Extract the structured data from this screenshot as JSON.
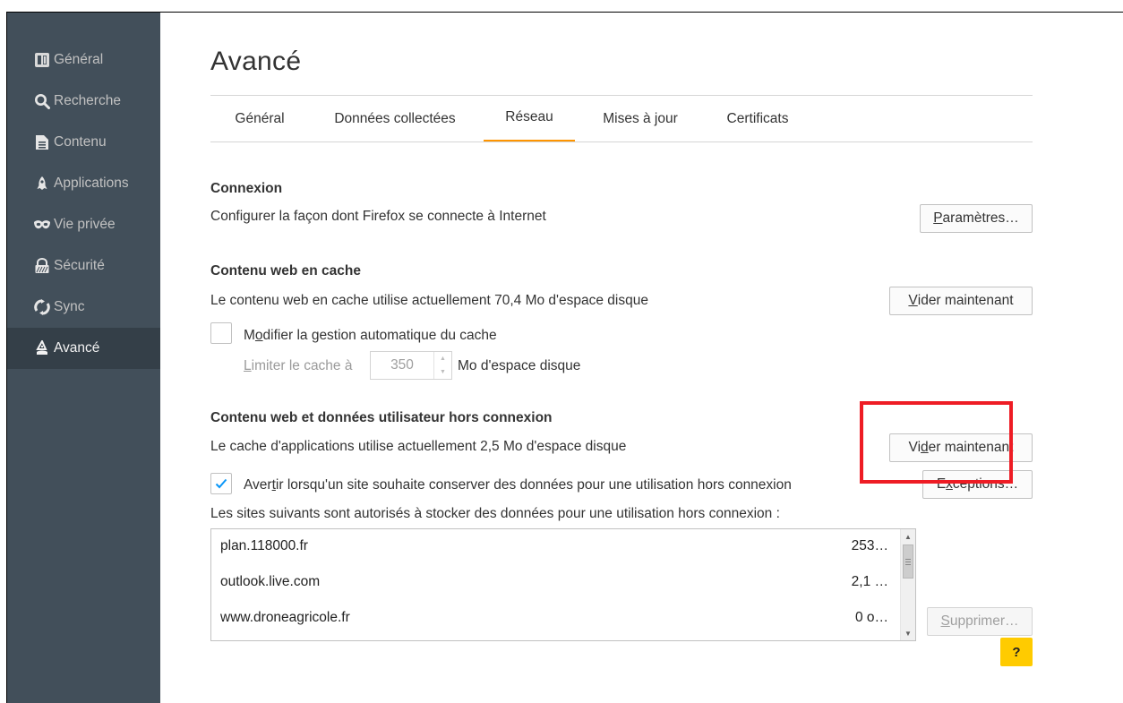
{
  "sidebar": {
    "items": [
      {
        "label": "Général",
        "icon": "general-icon"
      },
      {
        "label": "Recherche",
        "icon": "search-icon"
      },
      {
        "label": "Contenu",
        "icon": "content-icon"
      },
      {
        "label": "Applications",
        "icon": "applications-icon"
      },
      {
        "label": "Vie privée",
        "icon": "privacy-mask-icon"
      },
      {
        "label": "Sécurité",
        "icon": "security-icon"
      },
      {
        "label": "Sync",
        "icon": "sync-icon"
      },
      {
        "label": "Avancé",
        "icon": "advanced-icon",
        "active": true
      }
    ]
  },
  "header": {
    "title": "Avancé"
  },
  "tabs": [
    {
      "label": "Général"
    },
    {
      "label": "Données collectées"
    },
    {
      "label": "Réseau",
      "active": true
    },
    {
      "label": "Mises à jour"
    },
    {
      "label": "Certificats"
    }
  ],
  "connexion": {
    "title": "Connexion",
    "description": "Configurer la façon dont Firefox se connecte à Internet",
    "button_pre": "",
    "button_accel": "P",
    "button_post": "aramètres…"
  },
  "cache": {
    "title": "Contenu web en cache",
    "description": "Le contenu web en cache utilise actuellement 70,4 Mo d'espace disque",
    "button_pre": "",
    "button_accel": "V",
    "button_post": "ider maintenant",
    "override_pre": "M",
    "override_accel": "o",
    "override_post": "difier la gestion automatique du cache",
    "override_checked": false,
    "limit_pre": "",
    "limit_accel": "L",
    "limit_post": "imiter le cache à",
    "limit_value": "350",
    "limit_unit": "Mo d'espace disque"
  },
  "offline": {
    "title": "Contenu web et données utilisateur hors connexion",
    "description": "Le cache d'applications utilise actuellement 2,5 Mo d'espace disque",
    "button_pre": "Vi",
    "button_accel": "d",
    "button_post": "er maintenant",
    "warn_pre": "Aver",
    "warn_accel": "t",
    "warn_post": "ir lorsqu'un site souhaite conserver des données pour une utilisation hors connexion",
    "warn_checked": true,
    "exceptions_pre": "E",
    "exceptions_accel": "x",
    "exceptions_post": "ceptions…",
    "list_label": "Les sites suivants sont autorisés à stocker des données pour une utilisation hors connexion :",
    "sites": [
      {
        "site": "plan.118000.fr",
        "size": "253…"
      },
      {
        "site": "outlook.live.com",
        "size": "2,1 …"
      },
      {
        "site": "www.droneagricole.fr",
        "size": "0 o…"
      }
    ],
    "remove_pre": "",
    "remove_accel": "S",
    "remove_post": "upprimer…"
  },
  "help": {
    "label": "?"
  },
  "colors": {
    "sidebar_bg": "#424f5a",
    "sidebar_active": "#343f48",
    "tab_accent": "#ff9500",
    "help_bg": "#ffcb00",
    "highlight": "#ee1c24",
    "check": "#0996f8"
  }
}
